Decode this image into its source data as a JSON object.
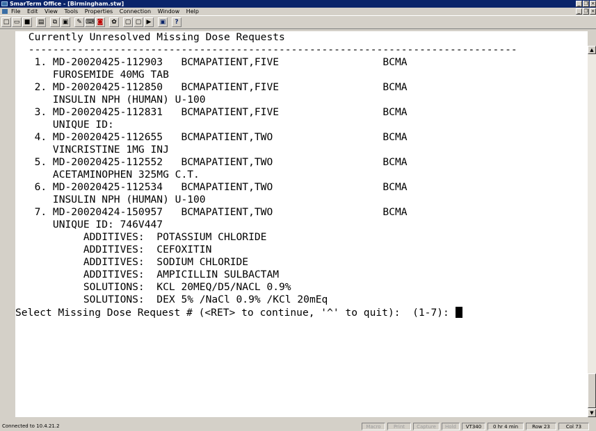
{
  "window": {
    "title": "SmarTerm Office - [Birmingham.stw]"
  },
  "menu": {
    "items": [
      "File",
      "Edit",
      "View",
      "Tools",
      "Properties",
      "Connection",
      "Window",
      "Help"
    ]
  },
  "terminal": {
    "lines": [
      " Currently Unresolved Missing Dose Requests",
      " --------------------------------------------------------------------------------",
      "  1. MD-20020425-112903   BCMAPATIENT,FIVE                 BCMA",
      "     FUROSEMIDE 40MG TAB",
      "  2. MD-20020425-112850   BCMAPATIENT,FIVE                 BCMA",
      "     INSULIN NPH (HUMAN) U-100",
      "  3. MD-20020425-112831   BCMAPATIENT,FIVE                 BCMA",
      "     UNIQUE ID:",
      "  4. MD-20020425-112655   BCMAPATIENT,TWO                  BCMA",
      "     VINCRISTINE 1MG INJ",
      "  5. MD-20020425-112552   BCMAPATIENT,TWO                  BCMA",
      "     ACETAMINOPHEN 325MG C.T.",
      "  6. MD-20020425-112534   BCMAPATIENT,TWO                  BCMA",
      "     INSULIN NPH (HUMAN) U-100",
      "  7. MD-20020424-150957   BCMAPATIENT,TWO                  BCMA",
      "     UNIQUE ID: 746V447",
      "          ADDITIVES:  POTASSIUM CHLORIDE",
      "          ADDITIVES:  CEFOXITIN",
      "          ADDITIVES:  SODIUM CHLORIDE",
      "          ADDITIVES:  AMPICILLIN SULBACTAM",
      "          SOLUTIONS:  KCL 20MEQ/D5/NACL 0.9%",
      "          SOLUTIONS:  DEX 5% /NaCl 0.9% /KCl 20mEq"
    ],
    "prompt": "Select Missing Dose Request # (<RET> to continue, '^' to quit):  (1-7): "
  },
  "status": {
    "connection": "Connected to 10.4.21.2",
    "macro": "Macro",
    "print": "Print",
    "capture": "Capture",
    "hold": "Hold",
    "emulation": "VT340",
    "time": "0 hr 4 min",
    "row": "Row 23",
    "col": "Col 73"
  }
}
